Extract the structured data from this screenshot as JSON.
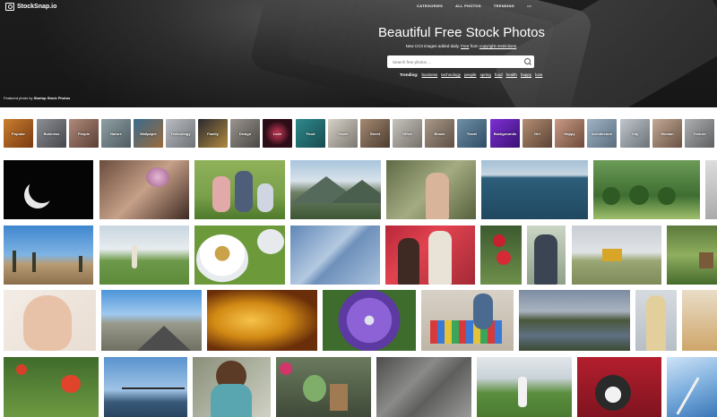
{
  "brand": {
    "name": "StockSnap.io"
  },
  "nav": {
    "items": [
      "CATEGORIES",
      "ALL PHOTOS",
      "TRENDING",
      "•••"
    ]
  },
  "hero": {
    "title": "Beautiful Free Stock Photos",
    "subtitle_pre": "New CC0 images added daily.",
    "subtitle_link1": "Free",
    "subtitle_mid": "from",
    "subtitle_link2": "copyright restrictions",
    "subtitle_end": "."
  },
  "search": {
    "placeholder": "Search free photos ..."
  },
  "trending": {
    "label": "Trending:",
    "terms": [
      "business",
      "technology",
      "people",
      "spring",
      "food",
      "health",
      "happy",
      "love"
    ]
  },
  "featured": {
    "prefix": "Featured photo by",
    "author": "Startup Stock Photos"
  },
  "categories": [
    "Popular",
    "Business",
    "People",
    "Nature",
    "Wallpaper",
    "Technology",
    "Family",
    "Design",
    "Love",
    "Food",
    "Travel",
    "Street",
    "Office",
    "Beach",
    "Travel",
    "Backgrounds",
    "Girl",
    "Happy",
    "Architecture",
    "City",
    "Woman",
    "Texture"
  ],
  "colors": {
    "accent": "#2b2b2b",
    "text_on_dark": "#ffffff"
  }
}
